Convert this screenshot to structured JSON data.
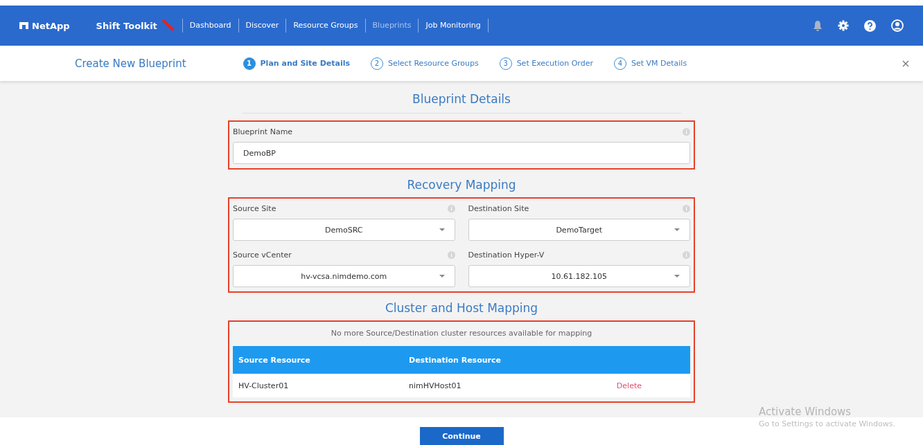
{
  "header": {
    "logo": "NetApp",
    "product": "Shift Toolkit",
    "nav": [
      {
        "label": "Dashboard",
        "selected": false
      },
      {
        "label": "Discover",
        "selected": false
      },
      {
        "label": "Resource Groups",
        "selected": false
      },
      {
        "label": "Blueprints",
        "selected": true
      },
      {
        "label": "Job Monitoring",
        "selected": false
      }
    ]
  },
  "wizard": {
    "title": "Create New Blueprint",
    "steps": [
      {
        "number": "1",
        "label": "Plan and Site Details",
        "selected": true
      },
      {
        "number": "2",
        "label": "Select Resource Groups",
        "selected": false
      },
      {
        "number": "3",
        "label": "Set Execution Order",
        "selected": false
      },
      {
        "number": "4",
        "label": "Set VM Details",
        "selected": false
      }
    ]
  },
  "blueprint_details": {
    "heading": "Blueprint Details",
    "highlighted": true,
    "name_label": "Blueprint Name",
    "name_value": "DemoBP"
  },
  "recovery_mapping": {
    "heading": "Recovery Mapping",
    "highlighted": true,
    "fields": [
      {
        "label": "Source Site",
        "value": "DemoSRC"
      },
      {
        "label": "Destination Site",
        "value": "DemoTarget"
      },
      {
        "label": "Source vCenter",
        "value": "hv-vcsa.nimdemo.com"
      },
      {
        "label": "Destination Hyper-V",
        "value": "10.61.182.105"
      }
    ]
  },
  "cluster_mapping": {
    "heading": "Cluster and Host Mapping",
    "highlighted": true,
    "notice": "No more Source/Destination cluster resources available for mapping",
    "columns": [
      "Source Resource",
      "Destination Resource"
    ],
    "rows": [
      {
        "source": "HV-Cluster01",
        "destination": "nimHVHost01",
        "action": "Delete"
      }
    ]
  },
  "footer": {
    "button": "Continue"
  },
  "os_overlay": {
    "title": "Activate Windows",
    "subtitle": "Go to Settings to activate Windows."
  }
}
